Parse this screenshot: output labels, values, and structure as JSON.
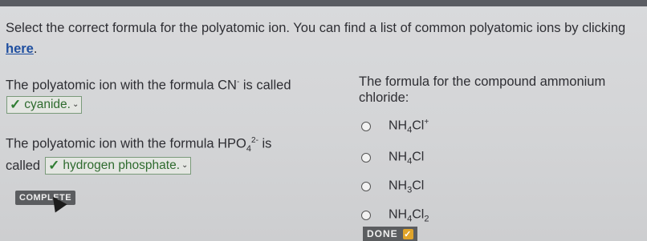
{
  "instructions": {
    "text": "Select the correct formula for the polyatomic ion. You can find a list of common polyatomic ions by clicking ",
    "link": "here",
    "end": "."
  },
  "q1": {
    "text_prefix": "The polyatomic ion with the formula CN",
    "superscript": "-",
    "text_suffix": " is called",
    "answer": "cyanide."
  },
  "q2": {
    "text_prefix": "The polyatomic ion with the formula HPO",
    "subscript": "4",
    "superscript": "2-",
    "text_suffix": " is",
    "text_line2": "called",
    "answer": "hydrogen phosphate."
  },
  "complete_label": "COMPLETE",
  "q3": {
    "text": "The formula for the compound ammonium chloride:",
    "options": [
      {
        "base": "NH",
        "sub": "4",
        "rest": "Cl",
        "sup": "+",
        "sub2": ""
      },
      {
        "base": "NH",
        "sub": "4",
        "rest": "Cl",
        "sup": "",
        "sub2": ""
      },
      {
        "base": "NH",
        "sub": "3",
        "rest": "Cl",
        "sup": "",
        "sub2": ""
      },
      {
        "base": "NH",
        "sub": "4",
        "rest": "Cl",
        "sup": "",
        "sub2": "2"
      }
    ]
  },
  "done_label": "DONE"
}
